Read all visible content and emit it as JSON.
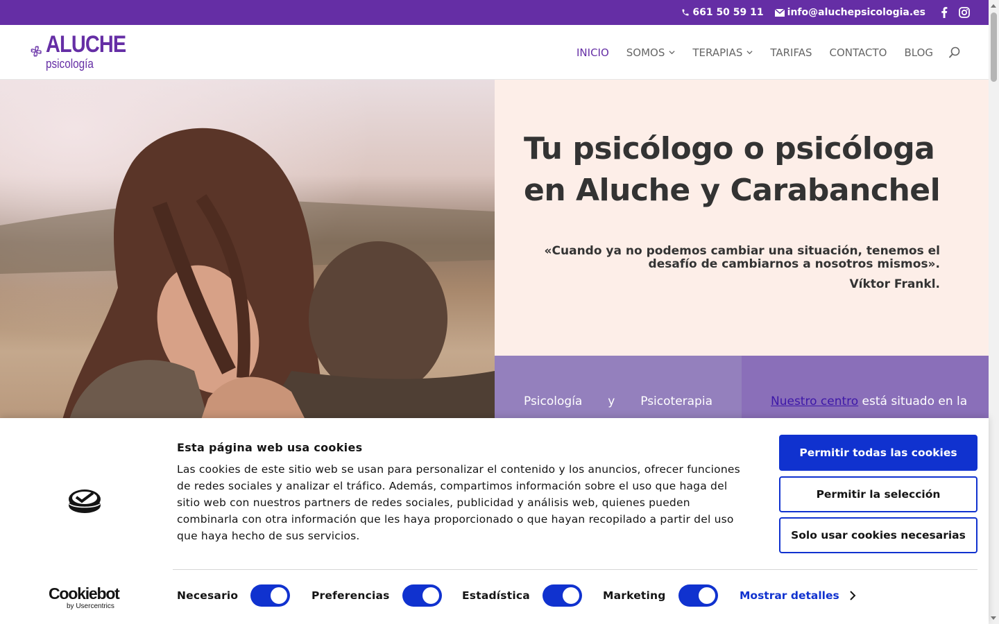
{
  "topbar": {
    "phone": "661 50 59 11",
    "email": "info@aluchepsicologia.es",
    "socials": [
      "facebook-icon",
      "instagram-icon"
    ]
  },
  "header": {
    "logo_line1": "ALUCHE",
    "logo_line2": "psicología",
    "nav": [
      {
        "label": "INICIO",
        "active": true,
        "dropdown": false
      },
      {
        "label": "SOMOS",
        "active": false,
        "dropdown": true
      },
      {
        "label": "TERAPIAS",
        "active": false,
        "dropdown": true
      },
      {
        "label": "TARIFAS",
        "active": false,
        "dropdown": false
      },
      {
        "label": "CONTACTO",
        "active": false,
        "dropdown": false
      },
      {
        "label": "BLOG",
        "active": false,
        "dropdown": false
      }
    ]
  },
  "hero": {
    "title": "Tu psicólogo o psicóloga en Aluche y Carabanchel",
    "quote": "«Cuando ya no podemos cambiar una situación, tenemos el desafío de cambiarnos a nosotros mismos».",
    "quote_author": "Víktor Frankl.",
    "col_a_words": [
      "Psicología",
      "y",
      "Psicoterapia"
    ],
    "col_b_link": "Nuestro centro",
    "col_b_text": " está situado en la"
  },
  "cookie": {
    "title": "Esta página web usa cookies",
    "text": "Las cookies de este sitio web se usan para personalizar el contenido y los anuncios, ofrecer funciones de redes sociales y analizar el tráfico. Además, compartimos información sobre el uso que haga del sitio web con nuestros partners de redes sociales, publicidad y análisis web, quienes pueden combinarla con otra información que les haya proporcionado o que hayan recopilado a partir del uso que haya hecho de sus servicios.",
    "btn_allow_all": "Permitir todas las cookies",
    "btn_allow_selection": "Permitir la selección",
    "btn_necessary_only": "Solo usar cookies necesarias",
    "toggles": [
      {
        "label": "Necesario",
        "on": true
      },
      {
        "label": "Preferencias",
        "on": true
      },
      {
        "label": "Estadística",
        "on": true
      },
      {
        "label": "Marketing",
        "on": true
      }
    ],
    "details_label": "Mostrar detalles",
    "brand": "Cookiebot",
    "brand_sub": "by Usercentrics"
  },
  "colors": {
    "brand_purple": "#652ea5",
    "hero_bg": "#fdeee8",
    "col_a": "#9480bd",
    "col_b": "#8a6fb9",
    "cookie_blue": "#1032cf"
  }
}
